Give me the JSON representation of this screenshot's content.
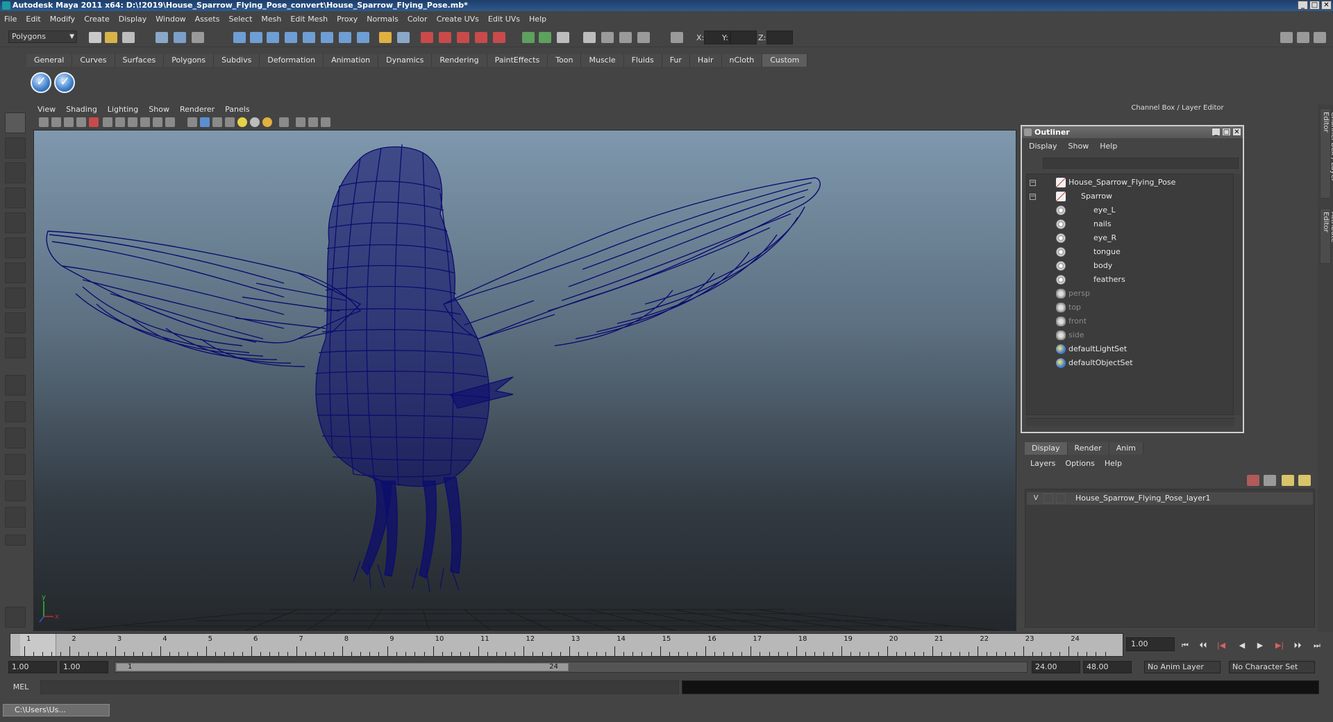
{
  "window": {
    "title": "Autodesk Maya 2011 x64: D:\\!2019\\House_Sparrow_Flying_Pose_convert\\House_Sparrow_Flying_Pose.mb*",
    "controls": [
      "_",
      "□",
      "✕"
    ]
  },
  "menubar": [
    "File",
    "Edit",
    "Modify",
    "Create",
    "Display",
    "Window",
    "Assets",
    "Select",
    "Mesh",
    "Edit Mesh",
    "Proxy",
    "Normals",
    "Color",
    "Create UVs",
    "Edit UVs",
    "Help"
  ],
  "statusline": {
    "mode": "Polygons",
    "coords": {
      "x": "X:",
      "y": "Y:",
      "z": "Z:"
    }
  },
  "shelf": {
    "tabs": [
      "General",
      "Curves",
      "Surfaces",
      "Polygons",
      "Subdivs",
      "Deformation",
      "Animation",
      "Dynamics",
      "Rendering",
      "PaintEffects",
      "Toon",
      "Muscle",
      "Fluids",
      "Fur",
      "Hair",
      "nCloth",
      "Custom"
    ],
    "active_tab": "Custom"
  },
  "panel": {
    "menu": [
      "View",
      "Shading",
      "Lighting",
      "Show",
      "Renderer",
      "Panels"
    ],
    "axis": {
      "y": "y",
      "x": "x"
    }
  },
  "channelbox": {
    "header": "Channel Box / Layer Editor",
    "side_tabs": [
      "Channel Box / Layer Editor",
      "Attribute Editor"
    ]
  },
  "outliner": {
    "title": "Outliner",
    "menu": [
      "Display",
      "Show",
      "Help"
    ],
    "items": [
      {
        "label": "House_Sparrow_Flying_Pose",
        "icon": "mesh-icon",
        "expanded": true
      },
      {
        "label": "Sparrow",
        "icon": "mesh-icon",
        "expanded": true
      },
      {
        "label": "eye_L",
        "icon": "node-icon"
      },
      {
        "label": "nails",
        "icon": "node-icon"
      },
      {
        "label": "eye_R",
        "icon": "node-icon"
      },
      {
        "label": "tongue",
        "icon": "node-icon"
      },
      {
        "label": "body",
        "icon": "node-icon"
      },
      {
        "label": "feathers",
        "icon": "node-icon"
      },
      {
        "label": "persp",
        "icon": "camera-icon"
      },
      {
        "label": "top",
        "icon": "camera-icon"
      },
      {
        "label": "front",
        "icon": "camera-icon"
      },
      {
        "label": "side",
        "icon": "camera-icon"
      },
      {
        "label": "defaultLightSet",
        "icon": "set-icon"
      },
      {
        "label": "defaultObjectSet",
        "icon": "set-icon"
      }
    ]
  },
  "layer_editor": {
    "tabs": [
      "Display",
      "Render",
      "Anim"
    ],
    "active_tab": "Display",
    "menu": [
      "Layers",
      "Options",
      "Help"
    ],
    "layers": [
      {
        "visible": "V",
        "name": "House_Sparrow_Flying_Pose_layer1"
      }
    ]
  },
  "timeline": {
    "ticks": [
      "1",
      "2",
      "3",
      "4",
      "5",
      "6",
      "7",
      "8",
      "9",
      "10",
      "11",
      "12",
      "13",
      "14",
      "15",
      "16",
      "17",
      "18",
      "19",
      "20",
      "21",
      "22",
      "23",
      "24"
    ],
    "current_frame": "1",
    "frame_field": "1.00",
    "playback": [
      "⏮",
      "⏴⏴",
      "|◀",
      "◀",
      "▶",
      "▶|",
      "⏵⏵",
      "⏭"
    ]
  },
  "range": {
    "start": "1.00",
    "anim_start": "1.00",
    "thumb_start": "1",
    "thumb_end": "24",
    "anim_end": "24.00",
    "end": "48.00",
    "anim_layer": "No Anim Layer",
    "character_set": "No Character Set"
  },
  "cmdline": {
    "label": "MEL"
  },
  "taskbar": {
    "window": "C:\\Users\\Us..."
  },
  "colors": {
    "wireframe": "#0c0c6e",
    "active_tab": "#5d5d5d",
    "title_bar": "#2c5a8e"
  }
}
